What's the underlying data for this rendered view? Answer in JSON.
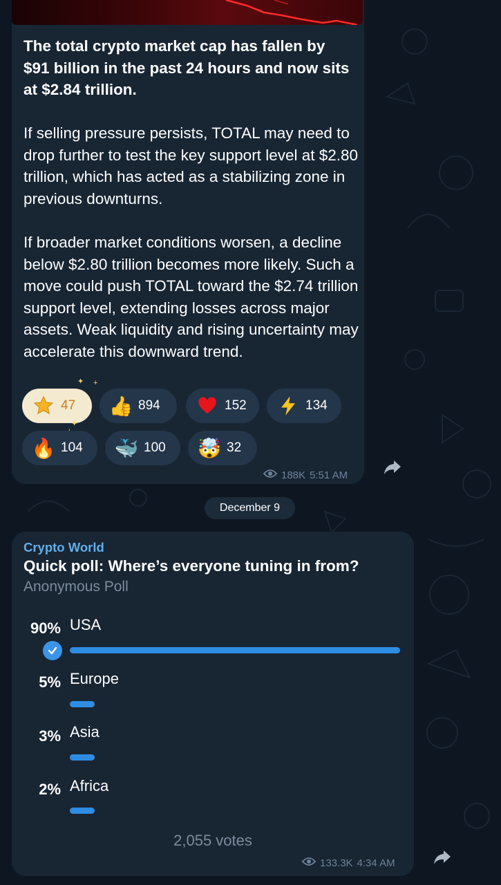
{
  "post1": {
    "title": "The total crypto market cap has fallen by $91 billion in the past 24 hours and now sits at $2.84 trillion.",
    "paragraph1": "If selling pressure persists, TOTAL may need to drop further to test the key support level at $2.80 trillion, which has acted as a stabilizing zone in previous downturns.",
    "paragraph2": "If broader market conditions worsen, a decline below $2.80 trillion becomes more likely. Such a move could push TOTAL toward the $2.74 trillion support level, extending losses across major assets. Weak liquidity and rising uncertainty may accelerate this downward trend.",
    "reactions": [
      {
        "icon": "star-icon",
        "emoji": "⭐",
        "count": "47"
      },
      {
        "icon": "thumbs-up-icon",
        "emoji": "👍",
        "count": "894"
      },
      {
        "icon": "heart-icon",
        "emoji": "❤️",
        "count": "152"
      },
      {
        "icon": "lightning-icon",
        "emoji": "⚡",
        "count": "134"
      },
      {
        "icon": "fire-icon",
        "emoji": "🔥",
        "count": "104"
      },
      {
        "icon": "whale-icon",
        "emoji": "🐳",
        "count": "100"
      },
      {
        "icon": "mind-blown-icon",
        "emoji": "🤯",
        "count": "32"
      }
    ],
    "views": "188K",
    "time": "5:51 AM"
  },
  "date_separator": "December 9",
  "post2": {
    "sender": "Crypto World",
    "question": "Quick poll: Where’s everyone tuning in from?",
    "poll_type": "Anonymous Poll",
    "options": [
      {
        "percent": "90%",
        "label": "USA",
        "fraction": 0.9,
        "selected": true
      },
      {
        "percent": "5%",
        "label": "Europe",
        "fraction": 0.05
      },
      {
        "percent": "3%",
        "label": "Asia",
        "fraction": 0.03
      },
      {
        "percent": "2%",
        "label": "Africa",
        "fraction": 0.02
      }
    ],
    "votes": "2,055 votes",
    "views": "133.3K",
    "time": "4:34 AM"
  },
  "colors": {
    "background": "#0e1621",
    "bubble": "#182533",
    "accent": "#2f8ce3",
    "sender": "#61aee8",
    "meta": "#6d8399"
  }
}
